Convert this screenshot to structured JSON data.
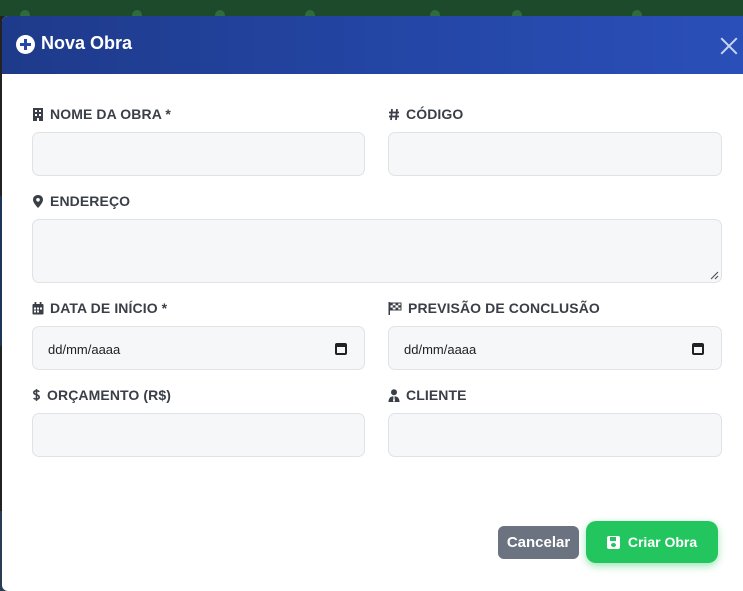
{
  "modal": {
    "title": "Nova Obra",
    "header_icon": "plus-circle-icon",
    "close_icon": "close-icon"
  },
  "fields": {
    "nome": {
      "label": "NOME DA OBRA *",
      "icon": "building-icon",
      "value": ""
    },
    "codigo": {
      "label": "CÓDIGO",
      "icon": "hashtag-icon",
      "value": ""
    },
    "endereco": {
      "label": "ENDEREÇO",
      "icon": "map-marker-icon",
      "value": ""
    },
    "data_inicio": {
      "label": "DATA DE INÍCIO *",
      "icon": "calendar-icon",
      "placeholder": "dd/mm/aaaa"
    },
    "previsao": {
      "label": "PREVISÃO DE CONCLUSÃO",
      "icon": "flag-checkered-icon",
      "placeholder": "dd/mm/aaaa"
    },
    "orcamento": {
      "label": "ORÇAMENTO (R$)",
      "icon": "dollar-icon",
      "value": ""
    },
    "cliente": {
      "label": "CLIENTE",
      "icon": "user-tie-icon",
      "value": ""
    }
  },
  "actions": {
    "cancel_label": "Cancelar",
    "create_label": "Criar Obra",
    "create_icon": "save-icon"
  },
  "colors": {
    "header_start": "#1e3a8a",
    "header_end": "#2a4fb8",
    "primary_green": "#22c55e",
    "cancel_gray": "#6b7280"
  }
}
